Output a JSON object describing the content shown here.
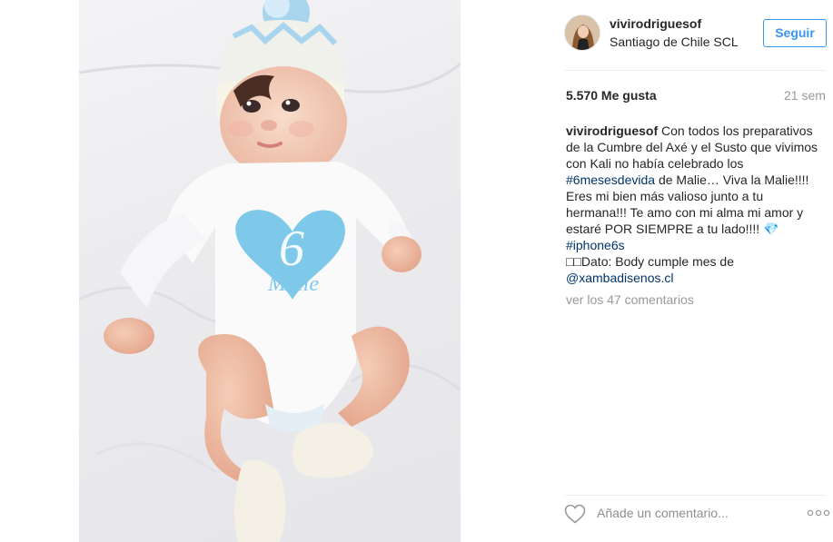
{
  "post": {
    "username": "vivirodriguesof",
    "location": "Santiago de Chile SCL",
    "follow_label": "Seguir",
    "likes": "5.570 Me gusta",
    "time": "21 sem",
    "caption": {
      "user": "vivirodriguesof",
      "text_1": " Con todos los preparativos de la Cumbre del Axé y el Susto que vivimos con Kali no había celebrado los ",
      "hashtag_1": "#6mesesdevida",
      "text_2": " de Malie… Viva la Malie!!!! Eres mi bien más valioso junto a tu hermana!!! Te amo con mi alma mi amor y estaré POR SIEMPRE a tu lado!!!! 💎 ",
      "hashtag_2": "#iphone6s",
      "text_3": "□□Dato: Body cumple mes de ",
      "mention": "@xambadisenos.cl"
    },
    "view_comments": "ver los 47 comentarios",
    "comment_placeholder": "Añade un comentario...",
    "photo_print_number": "6",
    "photo_print_name": "Malie"
  },
  "icons": {
    "like": "heart-outline-icon",
    "more": "ellipsis-icon"
  },
  "colors": {
    "accent": "#3897f0",
    "link": "#003569",
    "muted": "#999999",
    "print_blue": "#7ec8ea"
  }
}
